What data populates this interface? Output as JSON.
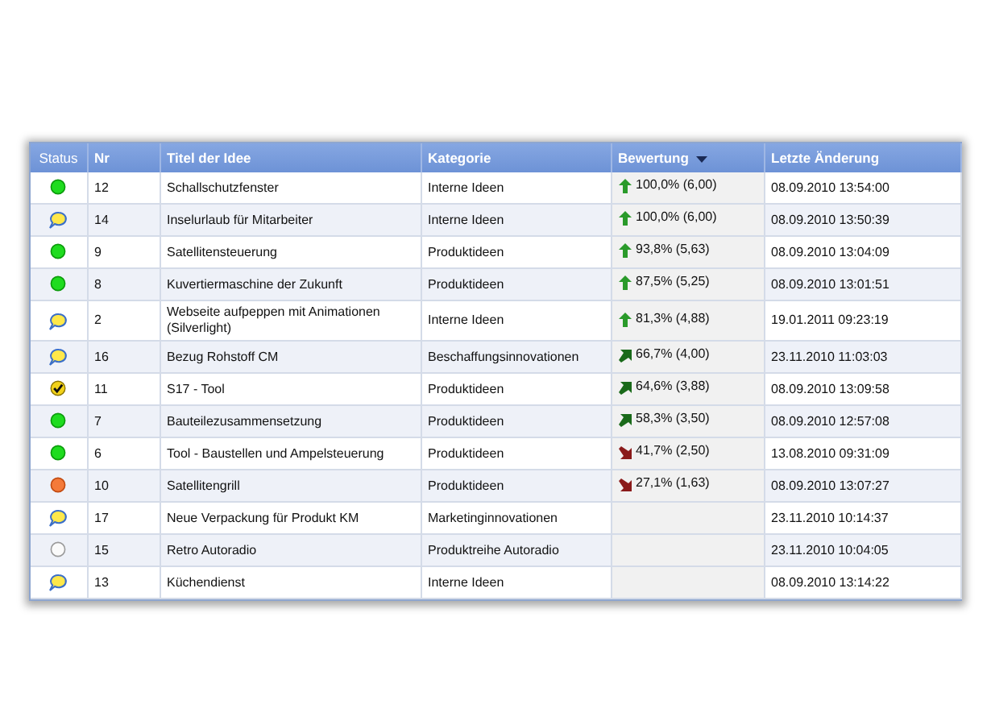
{
  "table": {
    "columns": [
      {
        "label": "Status",
        "sorted": false
      },
      {
        "label": "Nr",
        "sorted": false
      },
      {
        "label": "Titel der Idee",
        "sorted": false
      },
      {
        "label": "Kategorie",
        "sorted": false
      },
      {
        "label": "Bewertung",
        "sorted": true
      },
      {
        "label": "Letzte Änderung",
        "sorted": false
      }
    ],
    "rows": [
      {
        "status": {
          "kind": "green"
        },
        "nr": "12",
        "title": "Schallschutzfenster",
        "category": "Interne Ideen",
        "trend": {
          "kind": "up"
        },
        "rating": "100,0% (6,00)",
        "changed": "08.09.2010 13:54:00"
      },
      {
        "status": {
          "kind": "comment"
        },
        "nr": "14",
        "title": "Inselurlaub für Mitarbeiter",
        "category": "Interne Ideen",
        "trend": {
          "kind": "up"
        },
        "rating": "100,0% (6,00)",
        "changed": "08.09.2010 13:50:39"
      },
      {
        "status": {
          "kind": "green"
        },
        "nr": "9",
        "title": "Satellitensteuerung",
        "category": "Produktideen",
        "trend": {
          "kind": "up"
        },
        "rating": "93,8% (5,63)",
        "changed": "08.09.2010 13:04:09"
      },
      {
        "status": {
          "kind": "green"
        },
        "nr": "8",
        "title": "Kuvertiermaschine der Zukunft",
        "category": "Produktideen",
        "trend": {
          "kind": "up"
        },
        "rating": "87,5% (5,25)",
        "changed": "08.09.2010 13:01:51"
      },
      {
        "status": {
          "kind": "comment"
        },
        "nr": "2",
        "title": "Webseite aufpeppen mit Animationen (Silverlight)",
        "category": "Interne Ideen",
        "trend": {
          "kind": "up"
        },
        "rating": "81,3% (4,88)",
        "changed": "19.01.2011 09:23:19"
      },
      {
        "status": {
          "kind": "comment"
        },
        "nr": "16",
        "title": "Bezug Rohstoff CM",
        "category": "Beschaffungsinnovationen",
        "trend": {
          "kind": "rising"
        },
        "rating": "66,7% (4,00)",
        "changed": "23.11.2010 11:03:03"
      },
      {
        "status": {
          "kind": "check"
        },
        "nr": "11",
        "title": "S17 - Tool",
        "category": "Produktideen",
        "trend": {
          "kind": "rising"
        },
        "rating": "64,6% (3,88)",
        "changed": "08.09.2010 13:09:58"
      },
      {
        "status": {
          "kind": "green"
        },
        "nr": "7",
        "title": "Bauteilezusammensetzung",
        "category": "Produktideen",
        "trend": {
          "kind": "rising"
        },
        "rating": "58,3% (3,50)",
        "changed": "08.09.2010 12:57:08"
      },
      {
        "status": {
          "kind": "green"
        },
        "nr": "6",
        "title": "Tool - Baustellen und Ampelsteuerung",
        "category": "Produktideen",
        "trend": {
          "kind": "falling"
        },
        "rating": "41,7% (2,50)",
        "changed": "13.08.2010 09:31:09"
      },
      {
        "status": {
          "kind": "orange"
        },
        "nr": "10",
        "title": "Satellitengrill",
        "category": "Produktideen",
        "trend": {
          "kind": "falling"
        },
        "rating": "27,1% (1,63)",
        "changed": "08.09.2010 13:07:27"
      },
      {
        "status": {
          "kind": "comment"
        },
        "nr": "17",
        "title": "Neue Verpackung für Produkt KM",
        "category": "Marketinginnovationen",
        "changed": "23.11.2010 10:14:37"
      },
      {
        "status": {
          "kind": "white"
        },
        "nr": "15",
        "title": "Retro Autoradio",
        "category": "Produktreihe Autoradio",
        "changed": "23.11.2010 10:04:05"
      },
      {
        "status": {
          "kind": "comment"
        },
        "nr": "13",
        "title": "Küchendienst",
        "category": "Interne Ideen",
        "changed": "08.09.2010 13:14:22"
      }
    ]
  }
}
